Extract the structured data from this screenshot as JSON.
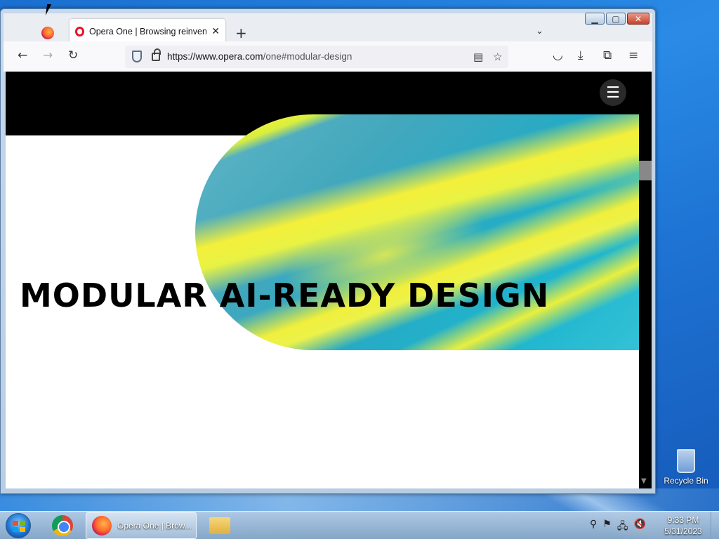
{
  "browser": {
    "tab_title": "Opera One | Browsing reinvente",
    "url_host": "https://www.opera.com",
    "url_path": "/one#modular-design",
    "icons": {
      "back": "arrow-left-icon",
      "forward": "arrow-right-icon",
      "reload": "reload-icon",
      "reader": "reader-view-icon",
      "bookmark": "star-icon",
      "pocket": "pocket-icon",
      "downloads": "download-icon",
      "extensions": "puzzle-icon",
      "menu": "hamburger-icon"
    }
  },
  "page": {
    "headline": "MODULAR AI-READY DESIGN",
    "menu_icon": "hamburger-icon"
  },
  "desktop": {
    "recycle_bin_label": "Recycle Bin"
  },
  "taskbar": {
    "firefox_label": "Opera One | Brow...",
    "time": "9:33 PM",
    "date": "5/31/2023"
  },
  "colors": {
    "opera_red": "#e1152a",
    "hero_teal": "#27aac4",
    "hero_yellow": "#f1f03a"
  }
}
